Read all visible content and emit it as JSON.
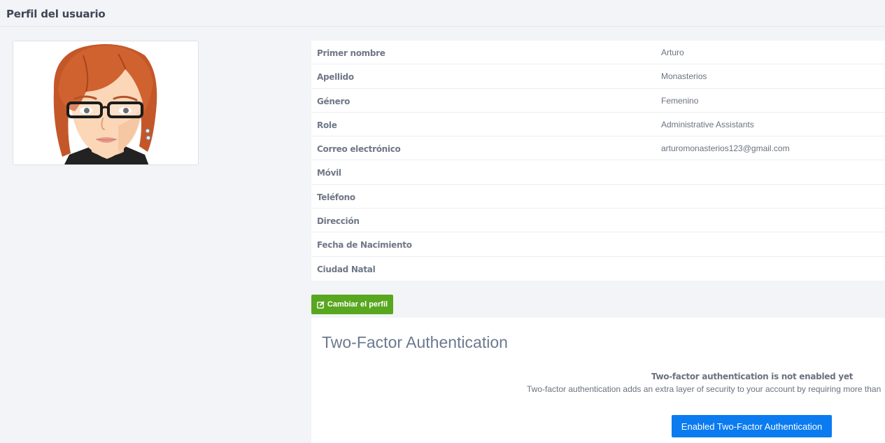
{
  "header": {
    "title": "Perfil del usuario"
  },
  "avatar": {
    "icon": "user-avatar-illustration"
  },
  "profile": {
    "fields": [
      {
        "label": "Primer nombre",
        "value": "Arturo"
      },
      {
        "label": "Apellido",
        "value": "Monasterios"
      },
      {
        "label": "Género",
        "value": "Femenino"
      },
      {
        "label": "Role",
        "value": "Administrative Assistants"
      },
      {
        "label": "Correo electrónico",
        "value": "arturomonasterios123@gmail.com"
      },
      {
        "label": "Móvil",
        "value": ""
      },
      {
        "label": "Teléfono",
        "value": ""
      },
      {
        "label": "Dirección",
        "value": ""
      },
      {
        "label": "Fecha de Nacimiento",
        "value": ""
      },
      {
        "label": "Ciudad Natal",
        "value": ""
      }
    ]
  },
  "edit_button": {
    "label": "Cambiar el perfil",
    "icon": "edit-icon",
    "color": "#58a71f"
  },
  "two_factor": {
    "title": "Two-Factor Authentication",
    "status": "Two-factor authentication is not enabled yet",
    "description": "Two-factor authentication adds an extra layer of security to your account by requiring more than",
    "button_label": "Enabled Two-Factor Authentication",
    "button_color": "#0b7bf0"
  }
}
